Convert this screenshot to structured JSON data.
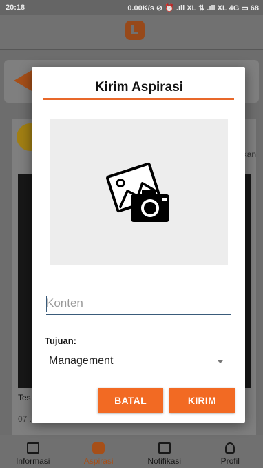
{
  "status_bar": {
    "time": "20:18",
    "right": "0.00K/s ⊘ ⏰ .ıll XL ⇅ .ıll XL 4G ▭ 68"
  },
  "background": {
    "post_side_text": "kan",
    "post_snippet": "Tes",
    "post_date": "07 ...., 2019 10:20"
  },
  "bottom_nav": [
    {
      "label": "Informasi",
      "icon": "news-icon",
      "active": false
    },
    {
      "label": "Aspirasi",
      "icon": "chat-icon",
      "active": true
    },
    {
      "label": "Notifikasi",
      "icon": "mail-icon",
      "active": false
    },
    {
      "label": "Profil",
      "icon": "person-icon",
      "active": false
    }
  ],
  "dialog": {
    "title": "Kirim Aspirasi",
    "image_picker_icon": "add-photo-camera-icon",
    "content_placeholder": "Konten",
    "target_label": "Tujuan:",
    "target_value": "Management",
    "cancel_label": "BATAL",
    "submit_label": "KIRIM",
    "accent_color": "#f26a23"
  }
}
